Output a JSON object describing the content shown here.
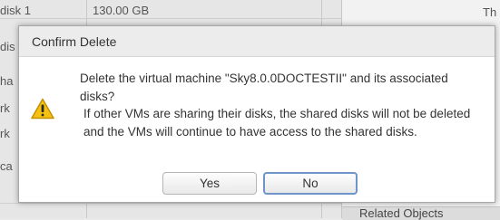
{
  "background": {
    "row_labels": [
      "disk 1",
      "dis",
      "ha",
      "rk",
      "rk",
      "ca"
    ],
    "disk_size": "130.00 GB",
    "right_header_fragment": "Th",
    "related_objects_label": "Related Objects"
  },
  "dialog": {
    "title": "Confirm Delete",
    "icon": "warning-icon",
    "message_line1": "Delete the virtual machine \"Sky8.0.0DOCTESTII\" and its associated disks?",
    "message_line2": "If other VMs are sharing their disks, the shared disks will not be deleted and the VMs will continue to have access to the shared disks.",
    "buttons": {
      "yes_label": "Yes",
      "no_label": "No"
    }
  },
  "colors": {
    "warning_fill": "#f5c211",
    "warning_stroke": "#c69000",
    "focus_border": "#6f95c8"
  }
}
